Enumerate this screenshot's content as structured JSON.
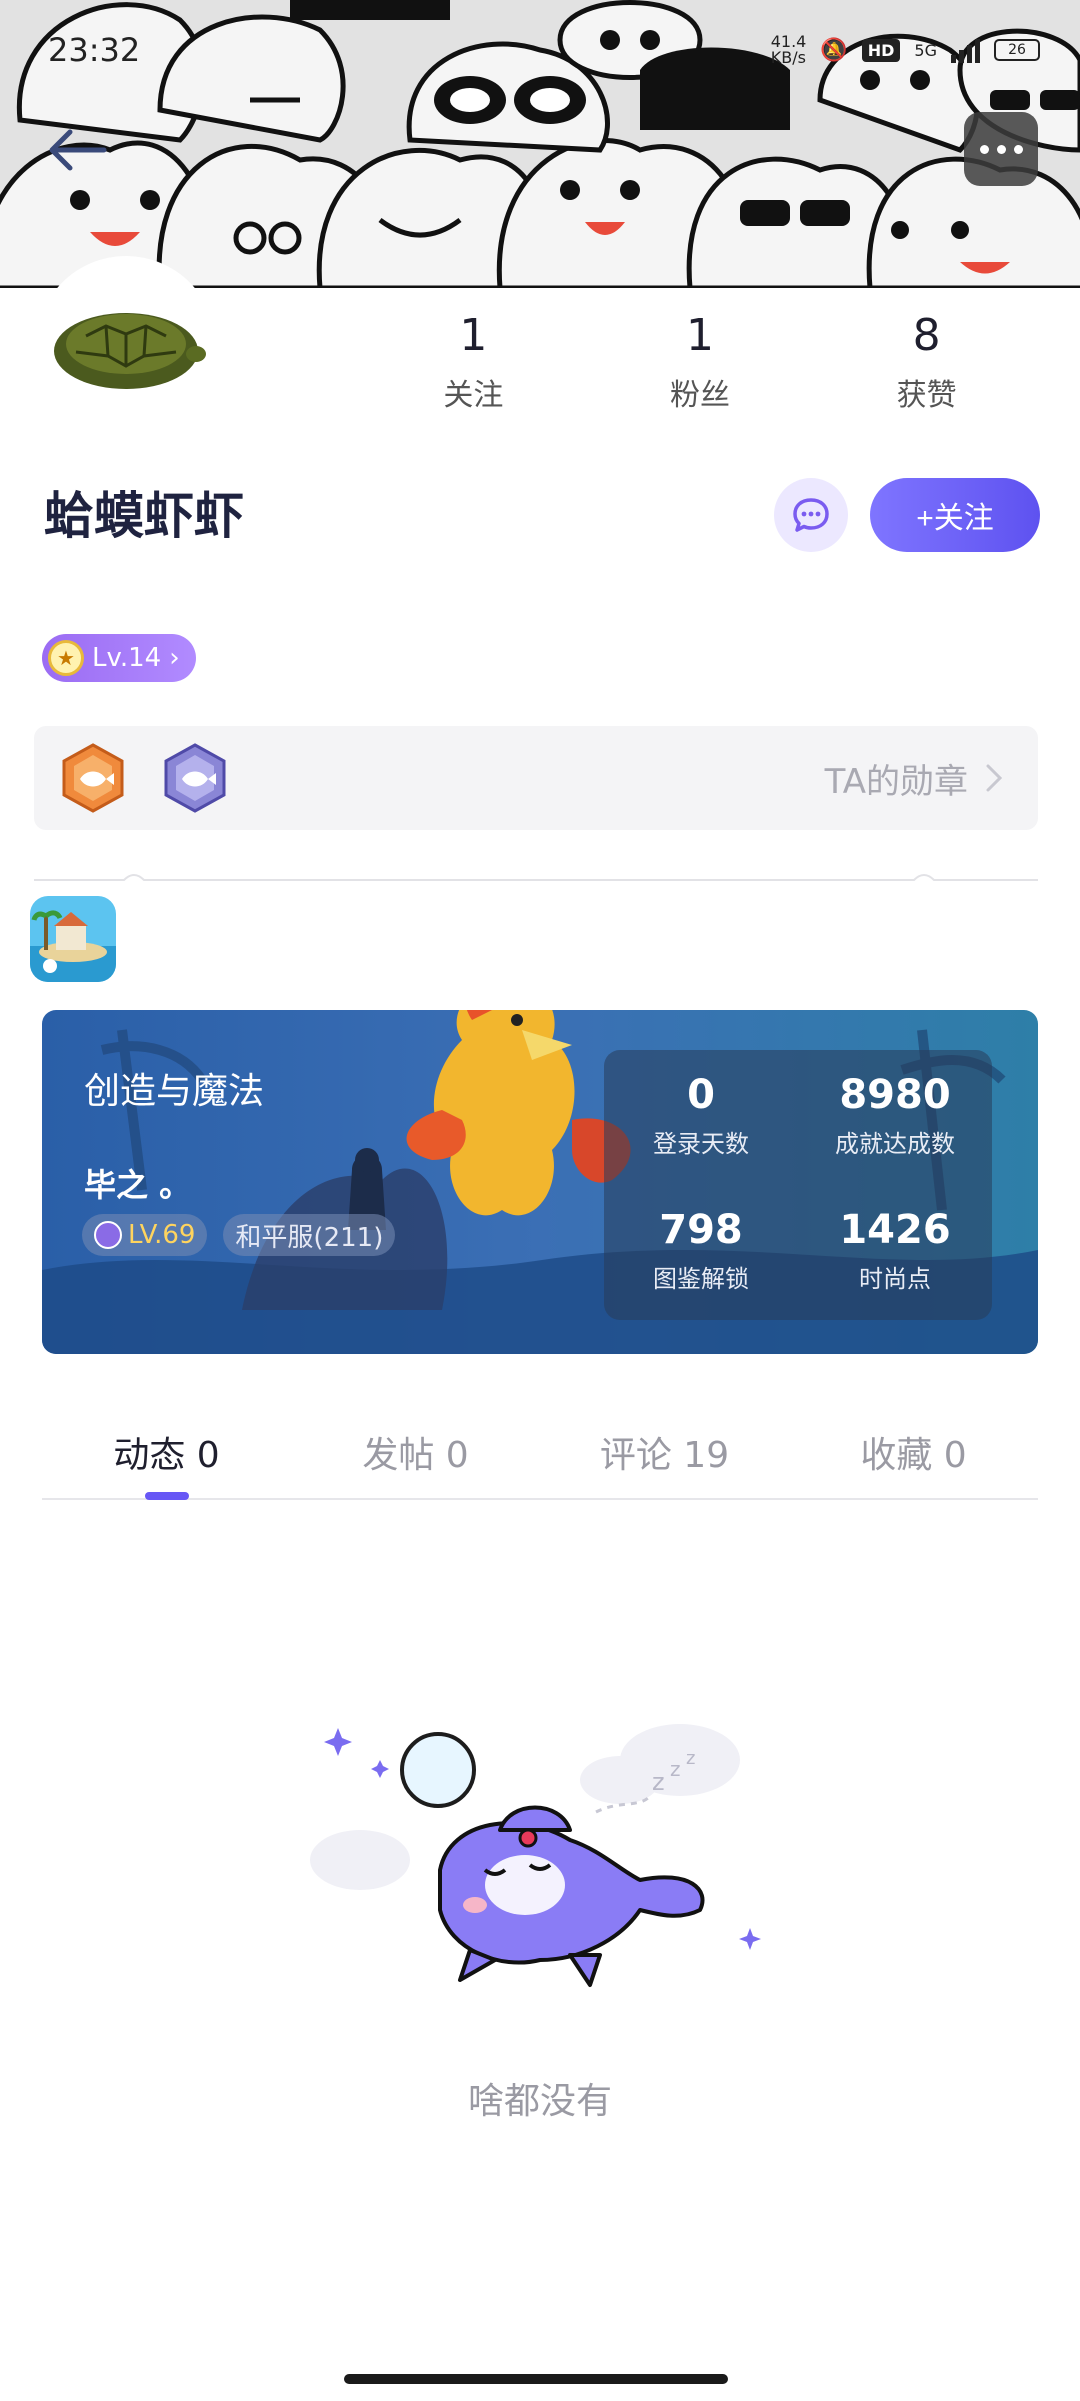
{
  "status_bar": {
    "time": "23:32",
    "net_speed": "41.4\nKB/s",
    "hd": "HD",
    "network": "5G",
    "battery": "26"
  },
  "header": {
    "back_icon": "arrow-left-icon",
    "more_icon": "more-dots-icon"
  },
  "profile": {
    "avatar_icon": "turtle-shell-avatar",
    "stats": [
      {
        "value": "1",
        "label": "关注"
      },
      {
        "value": "1",
        "label": "粉丝"
      },
      {
        "value": "8",
        "label": "获赞"
      }
    ],
    "username": "蛤蟆虾虾",
    "follow_label": "+关注",
    "level_label": "Lv.14",
    "medals_label": "TA的勋章"
  },
  "game": {
    "title": "创造与魔法",
    "player": "毕之 。",
    "level": "LV.69",
    "server": "和平服(211)",
    "stats": [
      {
        "value": "0",
        "label": "登录天数"
      },
      {
        "value": "8980",
        "label": "成就达成数"
      },
      {
        "value": "798",
        "label": "图鉴解锁"
      },
      {
        "value": "1426",
        "label": "时尚点"
      }
    ]
  },
  "tabs": [
    {
      "label": "动态 0",
      "active": true
    },
    {
      "label": "发帖 0",
      "active": false
    },
    {
      "label": "评论 19",
      "active": false
    },
    {
      "label": "收藏 0",
      "active": false
    }
  ],
  "empty_state": {
    "text": "啥都没有"
  },
  "colors": {
    "accent": "#6757f5",
    "level_badge": "#a479f7"
  }
}
